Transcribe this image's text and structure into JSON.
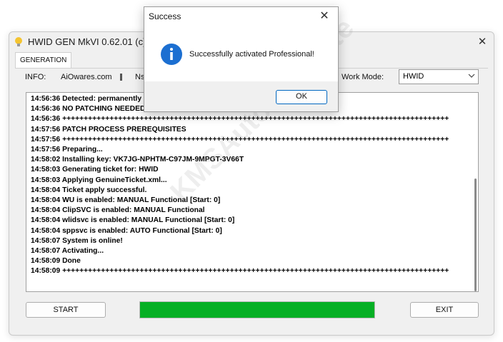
{
  "main_window": {
    "title": "HWID GEN MkVI 0.62.01 (c) Du",
    "close_glyph": "✕",
    "tab": "GENERATION",
    "info_label": "INFO:",
    "info_site": "AiOwares.com",
    "info_extra": "Ns",
    "work_mode_label": "Work Mode:",
    "work_mode_value": "HWID",
    "log_lines": [
      "14:56:36 Detected: permanently li",
      "14:56:36 NO PATCHING NEEDED!",
      "14:56:36 ++++++++++++++++++++++++++++++++++++++++++++++++++++++++++++++++++++++++++++++++++++++++++",
      "14:57:56 PATCH PROCESS PREREQUISITES",
      "14:57:56 ++++++++++++++++++++++++++++++++++++++++++++++++++++++++++++++++++++++++++++++++++++++++++",
      "14:57:56 Preparing...",
      "14:58:02 Installing key: VK7JG-NPHTM-C97JM-9MPGT-3V66T",
      "14:58:03 Generating ticket for: HWID",
      "14:58:03 Applying GenuineTicket.xml...",
      "14:58:04 Ticket apply successful.",
      "14:58:04 WU is enabled: MANUAL Functional [Start: 0]",
      "14:58:04 ClipSVC is enabled: MANUAL Functional",
      "14:58:04 wlidsvc is enabled: MANUAL Functional [Start: 0]",
      "14:58:04 sppsvc is enabled: AUTO Functional [Start: 0]",
      "14:58:07 System is online!",
      "14:58:07 Activating...",
      "14:58:09 Done",
      "14:58:09 ++++++++++++++++++++++++++++++++++++++++++++++++++++++++++++++++++++++++++++++++++++++++++"
    ],
    "start_label": "START",
    "exit_label": "EXIT",
    "progress_percent": 100,
    "progress_color": "#06b025"
  },
  "dialog": {
    "title": "Success",
    "close_glyph": "✕",
    "icon": "info-icon",
    "message": "Successfully activated Professional!",
    "ok_label": "OK",
    "accent": "#0067c0"
  },
  "watermark": "KMSAuto.Website"
}
